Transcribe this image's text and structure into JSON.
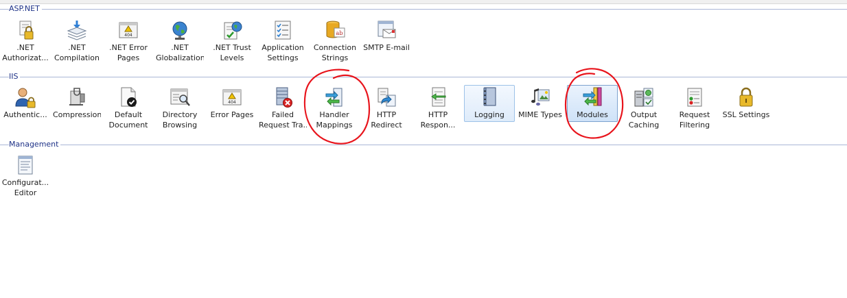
{
  "groups": {
    "aspnet": {
      "title": "ASP.NET",
      "items": [
        {
          "line1": ".NET",
          "line2": "Authorizat...",
          "icon": "lock-document-icon"
        },
        {
          "line1": ".NET",
          "line2": "Compilation",
          "icon": "stack-compile-icon"
        },
        {
          "line1": ".NET Error",
          "line2": "Pages",
          "icon": "error-404-icon"
        },
        {
          "line1": ".NET",
          "line2": "Globalization",
          "icon": "globe-icon"
        },
        {
          "line1": ".NET Trust",
          "line2": "Levels",
          "icon": "trust-document-icon"
        },
        {
          "line1": "Application",
          "line2": "Settings",
          "icon": "settings-list-icon"
        },
        {
          "line1": "Connection",
          "line2": "Strings",
          "icon": "database-icon"
        },
        {
          "line1": "SMTP E-mail",
          "line2": "",
          "icon": "email-icon"
        }
      ]
    },
    "iis": {
      "title": "IIS",
      "items": [
        {
          "line1": "Authentic...",
          "line2": "",
          "icon": "user-icon"
        },
        {
          "line1": "Compression",
          "line2": "",
          "icon": "compression-icon"
        },
        {
          "line1": "Default",
          "line2": "Document",
          "icon": "document-check-icon"
        },
        {
          "line1": "Directory",
          "line2": "Browsing",
          "icon": "browse-window-icon"
        },
        {
          "line1": "Error Pages",
          "line2": "",
          "icon": "error-404-icon"
        },
        {
          "line1": "Failed",
          "line2": "Request Tra...",
          "icon": "failed-log-icon"
        },
        {
          "line1": "Handler",
          "line2": "Mappings",
          "icon": "handler-arrows-icon"
        },
        {
          "line1": "HTTP",
          "line2": "Redirect",
          "icon": "redirect-icon"
        },
        {
          "line1": "HTTP",
          "line2": "Respon...",
          "icon": "http-response-icon"
        },
        {
          "line1": "Logging",
          "line2": "",
          "icon": "logbook-icon"
        },
        {
          "line1": "MIME Types",
          "line2": "",
          "icon": "mime-media-icon"
        },
        {
          "line1": "Modules",
          "line2": "",
          "icon": "modules-icon"
        },
        {
          "line1": "Output",
          "line2": "Caching",
          "icon": "output-cache-icon"
        },
        {
          "line1": "Request",
          "line2": "Filtering",
          "icon": "request-filter-icon"
        },
        {
          "line1": "SSL Settings",
          "line2": "",
          "icon": "padlock-icon"
        }
      ]
    },
    "management": {
      "title": "Management",
      "items": [
        {
          "line1": "Configurat...",
          "line2": "Editor",
          "icon": "config-editor-icon"
        }
      ]
    }
  },
  "colors": {
    "group_title": "#1e3287",
    "group_rule": "#a9b6d6",
    "selection": "#deebfa",
    "annotation": "#e8141c"
  }
}
